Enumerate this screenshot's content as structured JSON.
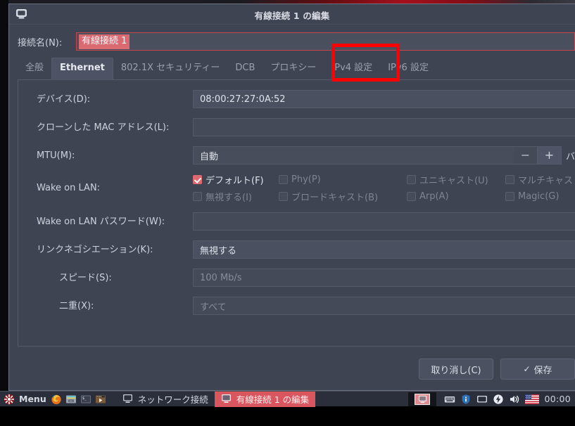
{
  "window": {
    "title": "有線接続 1 の編集",
    "titlebar_icon": "network-wired-icon"
  },
  "connection_name": {
    "label": "接続名(N):",
    "value": "有線接続 1"
  },
  "tabs": [
    {
      "label": "全般",
      "active": false
    },
    {
      "label": "Ethernet",
      "active": true
    },
    {
      "label": "802.1X セキュリティー",
      "active": false
    },
    {
      "label": "DCB",
      "active": false
    },
    {
      "label": "プロキシー",
      "active": false
    },
    {
      "label": "IPv4 設定",
      "active": false
    },
    {
      "label": "IPv6 設定",
      "active": false
    }
  ],
  "annotation": {
    "color": "#fe0000",
    "target_tab": "IPv4 設定"
  },
  "form": {
    "device": {
      "label": "デバイス(D):",
      "value": "08:00:27:27:0A:52"
    },
    "cloned_mac": {
      "label": "クローンした MAC アドレス(L):",
      "value": ""
    },
    "mtu": {
      "label": "MTU(M):",
      "value": "自動",
      "minus": "−",
      "plus": "+",
      "suffix": "バ"
    },
    "wake_on_lan": {
      "label": "Wake on LAN:",
      "options": [
        {
          "label": "デフォルト(F)",
          "checked": true
        },
        {
          "label": "Phy(P)",
          "checked": false
        },
        {
          "label": "ユニキャスト(U)",
          "checked": false
        },
        {
          "label": "マルチキャス",
          "checked": false
        },
        {
          "label": "無視する(I)",
          "checked": false
        },
        {
          "label": "ブロードキャスト(B)",
          "checked": false
        },
        {
          "label": "Arp(A)",
          "checked": false
        },
        {
          "label": "Magic(G)",
          "checked": false
        }
      ]
    },
    "wol_password": {
      "label": "Wake on LAN パスワード(W):",
      "value": ""
    },
    "link_negotiation": {
      "label": "リンクネゴシエーション(K):",
      "value": "無視する"
    },
    "speed": {
      "label": "スピード(S):",
      "value": "100 Mb/s"
    },
    "duplex": {
      "label": "二重(X):",
      "value": "すべて"
    }
  },
  "actions": {
    "cancel": "取り消し(C)",
    "save": "保存",
    "save_check": "✓"
  },
  "taskbar": {
    "menu_label": "Menu",
    "menu_icon": "star-menu-icon",
    "launchers": [
      {
        "name": "firefox-icon"
      },
      {
        "name": "file-manager-icon"
      },
      {
        "name": "terminal-icon"
      },
      {
        "name": "media-player-icon"
      }
    ],
    "tasks": [
      {
        "label": "ネットワーク接続",
        "icon": "window-icon",
        "active": false
      },
      {
        "label": "有線接続 1 の編集",
        "icon": "window-icon",
        "active": true
      }
    ],
    "tray": [
      {
        "name": "keyboard-icon"
      },
      {
        "name": "shield-info-icon"
      },
      {
        "name": "display-icon"
      },
      {
        "name": "power-bolt-icon"
      },
      {
        "name": "volume-icon"
      },
      {
        "name": "flag-us-icon"
      }
    ],
    "clock": "00:00"
  },
  "colors": {
    "window_bg": "#3f4452",
    "field_bg": "#484d5b",
    "accent_red": "#d9565f",
    "checkbox_checked": "#e0686f",
    "annotation": "#fe0000",
    "taskbar_bg": "#2b2f3b"
  }
}
